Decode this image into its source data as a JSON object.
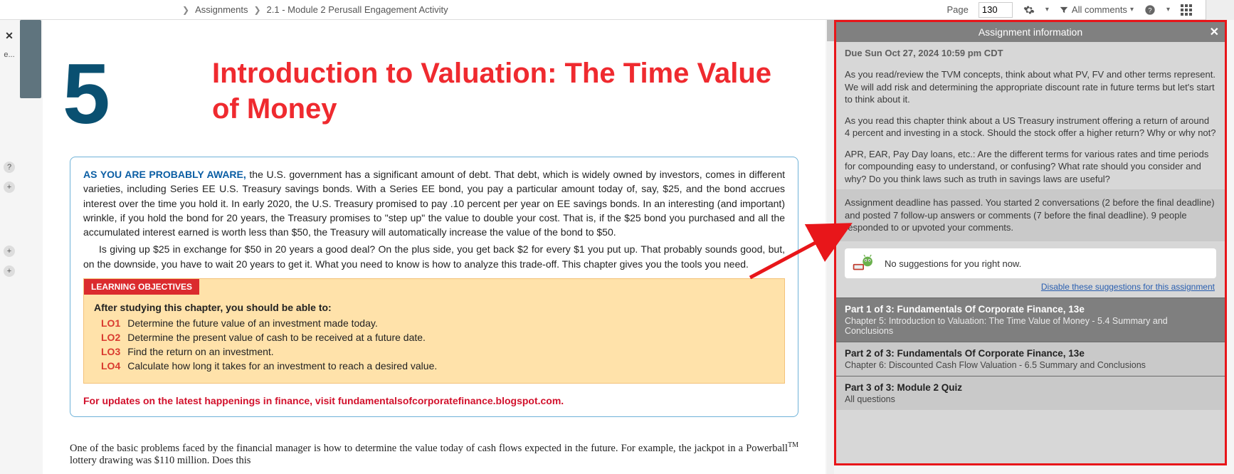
{
  "topbar": {
    "breadcrumb1": "Assignments",
    "breadcrumb2": "2.1 - Module 2 Perusall Engagement Activity",
    "page_label": "Page",
    "page_value": "130",
    "comments_label": "All comments"
  },
  "leftgutter": {
    "close": "✕",
    "e": "e...",
    "q": "?",
    "plus": "+"
  },
  "doc": {
    "chapnum": "5",
    "title": "Introduction to Valuation: The Time Value of Money",
    "lead": "AS YOU ARE PROBABLY AWARE,",
    "para1_rest": " the U.S. government has a significant amount of debt. That debt, which is widely owned by investors, comes in different varieties, including Series EE U.S. Treasury savings bonds. With a Series EE bond, you pay a particular amount today of, say, $25, and the bond accrues interest over the time you hold it. In early 2020, the U.S. Treasury promised to pay .10 percent per year on EE savings bonds. In an interesting (and important) wrinkle, if you hold the bond for 20 years, the Treasury promises to \"step up\" the value to double your cost. That is, if the $25 bond you purchased and all the accumulated interest earned is worth less than $50, the Treasury will automatically increase the value of the bond to $50.",
    "para2": "Is giving up $25 in exchange for $50 in 20 years a good deal? On the plus side, you get back $2 for every $1 you put up. That probably sounds good, but, on the downside, you have to wait 20 years to get it. What you need to know is how to analyze this trade-off. This chapter gives you the tools you need.",
    "lo_header": "LEARNING OBJECTIVES",
    "lo_after": "After studying this chapter, you should be able to:",
    "lo": [
      {
        "code": "LO1",
        "text": "Determine the future value of an investment made today."
      },
      {
        "code": "LO2",
        "text": "Determine the present value of cash to be received at a future date."
      },
      {
        "code": "LO3",
        "text": "Find the return on an investment."
      },
      {
        "code": "LO4",
        "text": "Calculate how long it takes for an investment to reach a desired value."
      }
    ],
    "update_link": "For updates on the latest happenings in finance, visit fundamentalsofcorporatefinance.blogspot.com.",
    "serif_a": "One of the basic problems faced by the financial manager is how to determine the value today of cash flows expected in the future. For example, the jackpot in a Powerball",
    "serif_tm": "TM",
    "serif_b": " lottery drawing was $110 million. Does this"
  },
  "panel": {
    "title": "Assignment information",
    "due": "Due Sun Oct 27, 2024 10:59 pm CDT",
    "p1": "As you read/review the TVM concepts, think about what PV, FV and other terms represent. We will add risk and determining the appropriate discount rate in future terms but let's start to think about it.",
    "p2": "As you read this chapter think about a US Treasury instrument offering a return of around 4 percent and investing in a stock. Should the stock offer a higher return? Why or why not?",
    "p3": "APR, EAR, Pay Day loans, etc.: Are the different terms for various rates and time periods for compounding easy to understand, or confusing? What rate should you consider and why? Do you think laws such as truth in savings laws are useful?",
    "status": "Assignment deadline has passed. You started 2 conversations (2 before the final deadline) and posted 7 follow-up answers or comments (7 before the final deadline). 9 people responded to or upvoted your comments.",
    "suggest": "No suggestions for you right now.",
    "disable": "Disable these suggestions for this assignment",
    "parts": [
      {
        "title": "Part 1 of 3: Fundamentals Of Corporate Finance, 13e",
        "desc": "Chapter 5: Introduction to Valuation: The Time Value of Money - 5.4 Summary and Conclusions"
      },
      {
        "title": "Part 2 of 3: Fundamentals Of Corporate Finance, 13e",
        "desc": "Chapter 6: Discounted Cash Flow Valuation - 6.5 Summary and Conclusions"
      },
      {
        "title": "Part 3 of 3: Module 2 Quiz",
        "desc": "All questions"
      }
    ]
  }
}
